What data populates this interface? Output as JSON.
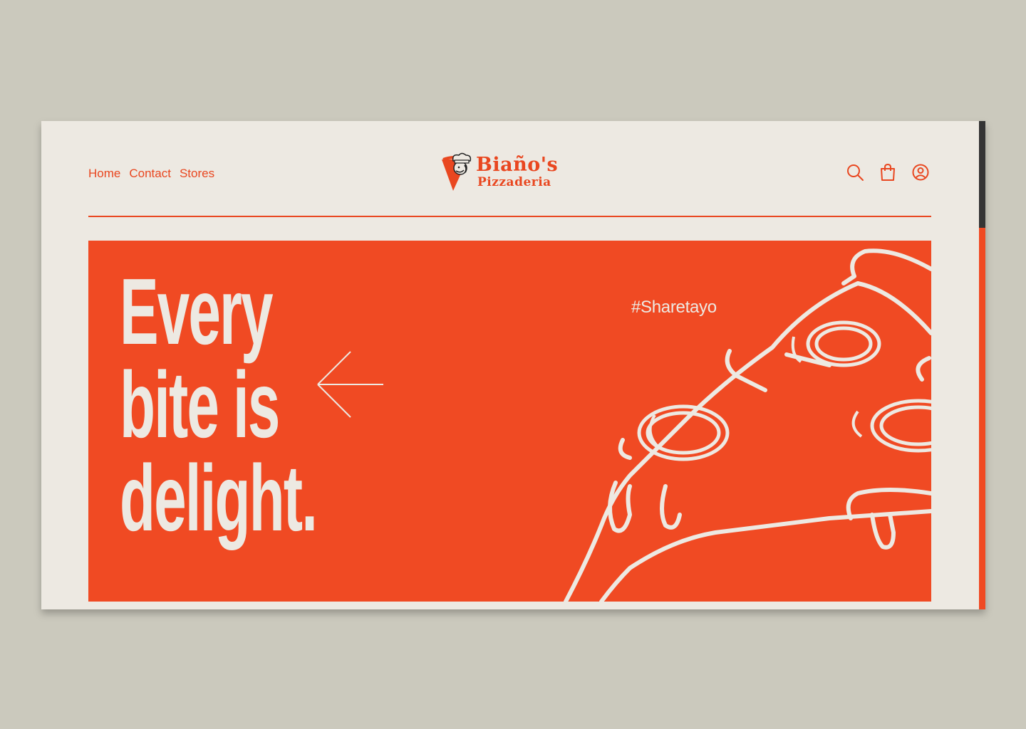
{
  "nav": {
    "items": [
      {
        "label": "Home"
      },
      {
        "label": "Contact"
      },
      {
        "label": "Stores"
      }
    ]
  },
  "logo": {
    "line1": "Biaño's",
    "line2": "Pizzaderia"
  },
  "header_icons": [
    "search-icon",
    "shopping-bag-icon",
    "user-account-icon"
  ],
  "hero": {
    "headline_lines": [
      "Every",
      "bite is",
      "delight."
    ],
    "hashtag": "#Sharetayo"
  },
  "colors": {
    "accent": "#f04a23",
    "background": "#ede9e2",
    "page_backdrop": "#cbc9bd",
    "scrollbar_thumb": "#343434"
  }
}
